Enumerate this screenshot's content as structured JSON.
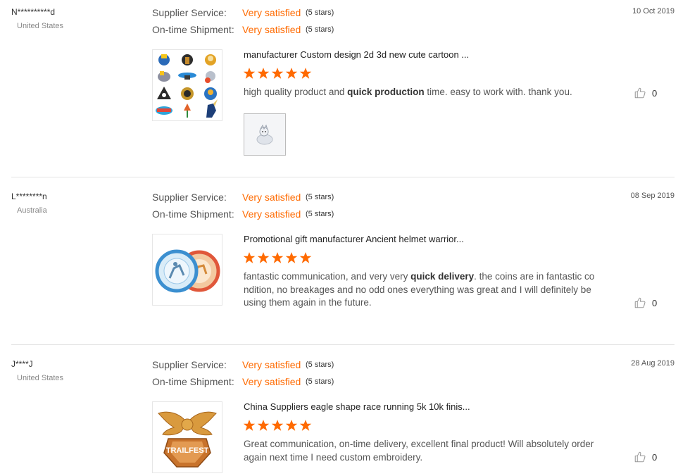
{
  "labels": {
    "supplier_service": "Supplier Service:",
    "on_time_shipment": "On-time Shipment:"
  },
  "colors": {
    "accent": "#ff6a00",
    "separator": "#e3e3e3"
  },
  "reviews": [
    {
      "buyer": "N**********d",
      "country": "United States",
      "date": "10 Oct 2019",
      "supplier_rating": "Very satisfied",
      "supplier_stars": "(5 stars)",
      "shipment_rating": "Very satisfied",
      "shipment_stars": "(5 stars)",
      "product_title": "manufacturer Custom design 2d 3d new cute cartoon ...",
      "stars": 5,
      "feedback_pre": "high quality product and ",
      "feedback_bold": "quick production",
      "feedback_post": " time. easy to work with. thank you.",
      "likes": "0",
      "thumb_icon": "cartoon-pins-grid-icon",
      "photo_icon": "enamel-pin-photo-icon"
    },
    {
      "buyer": "L********n",
      "country": "Australia",
      "date": "08 Sep 2019",
      "supplier_rating": "Very satisfied",
      "supplier_stars": "(5 stars)",
      "shipment_rating": "Very satisfied",
      "shipment_stars": "(5 stars)",
      "product_title": "Promotional gift manufacturer Ancient helmet warrior...",
      "stars": 5,
      "feedback_pre": "fantastic communication, and very very ",
      "feedback_bold": "quick delivery",
      "feedback_post": ". the coins are in fantastic condition, no breakages and no odd ones everything was great and I will definitely be using them again in the future.",
      "likes": "0",
      "thumb_icon": "warrior-coins-icon"
    },
    {
      "buyer": "J****J",
      "country": "United States",
      "date": "28 Aug 2019",
      "supplier_rating": "Very satisfied",
      "supplier_stars": "(5 stars)",
      "shipment_rating": "Very satisfied",
      "shipment_stars": "(5 stars)",
      "product_title": "China Suppliers eagle shape race running 5k 10k finis...",
      "stars": 5,
      "feedback_pre": "",
      "feedback_bold": "",
      "feedback_post": "Great communication, on-time delivery, excellent final product! Will absolutely order again next time I need custom embroidery.",
      "likes": "0",
      "thumb_icon": "eagle-medal-icon",
      "thumb_text": "TRAILFEST"
    }
  ]
}
